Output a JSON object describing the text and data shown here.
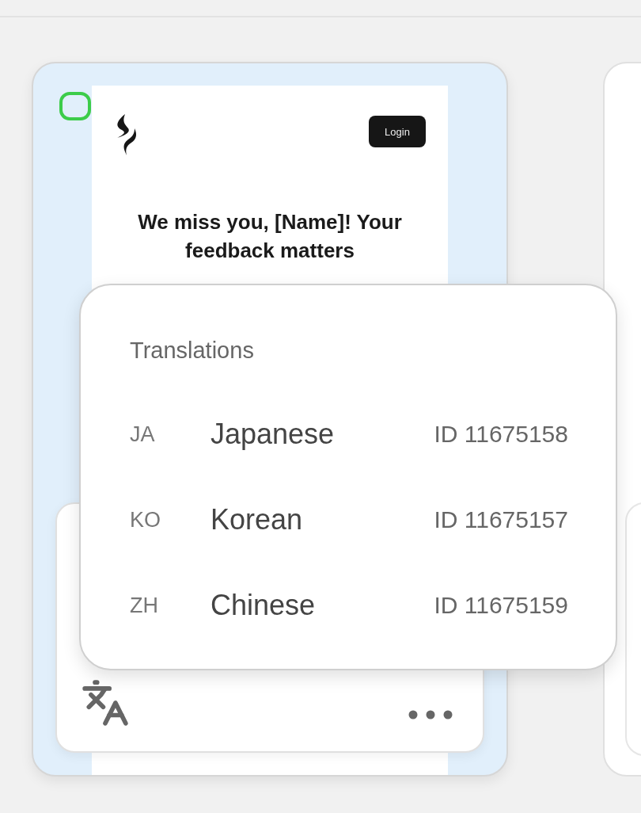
{
  "template_card": {
    "selected": false,
    "email_preview": {
      "login_button": "Login",
      "headline": "We miss you, [Name]! Your feedback matters"
    }
  },
  "translations": {
    "title": "Translations",
    "items": [
      {
        "code": "JA",
        "language": "Japanese",
        "id": "ID 11675158"
      },
      {
        "code": "KO",
        "language": "Korean",
        "id": "ID 11675157"
      },
      {
        "code": "ZH",
        "language": "Chinese",
        "id": "ID 11675159"
      }
    ]
  }
}
